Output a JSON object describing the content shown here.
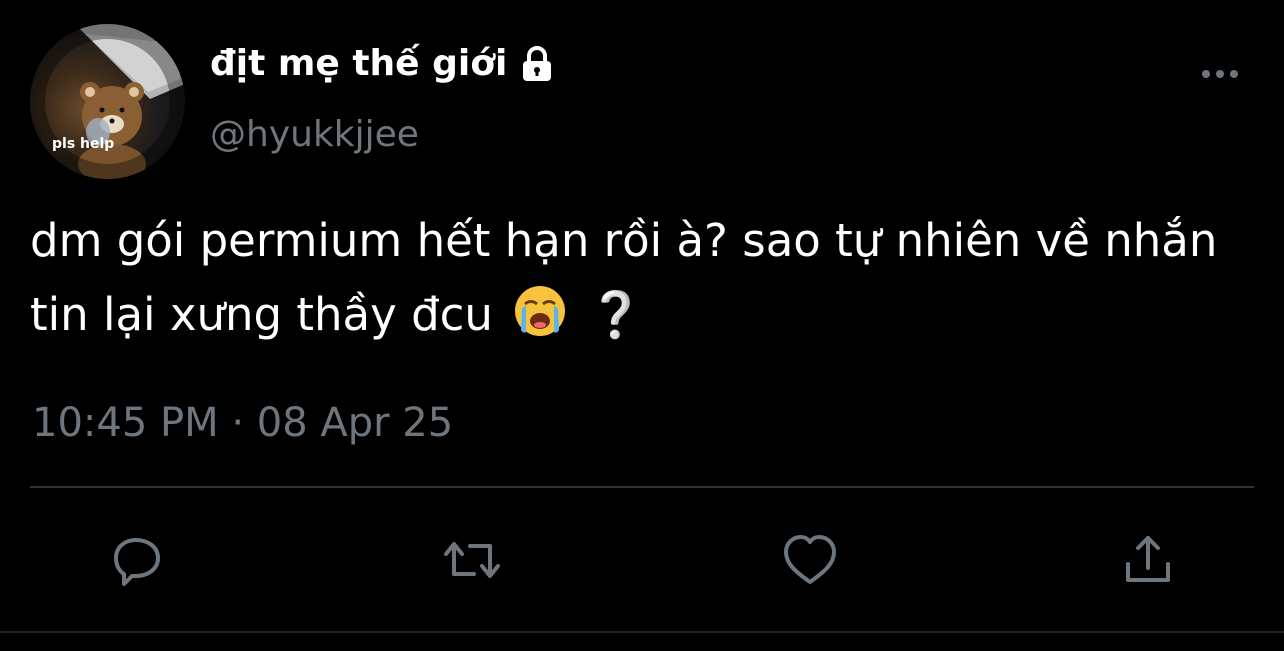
{
  "profile": {
    "display_name": "địt mẹ thế giới",
    "handle": "@hyukkjjee",
    "avatar_caption": "pls help",
    "protected": true
  },
  "tweet": {
    "text": "dm gói permium hết hạn rồi à? sao tự nhiên về nhắn tin lại xưng thầy đcu",
    "trailing_emoji": "loudly-crying-face",
    "trailing_mark": "❔",
    "timestamp": "10:45 PM · 08 Apr 25"
  },
  "actions": [
    {
      "name": "reply",
      "icon": "speech-bubble-icon"
    },
    {
      "name": "retweet",
      "icon": "retweet-arrows-icon"
    },
    {
      "name": "like",
      "icon": "heart-icon"
    },
    {
      "name": "share",
      "icon": "share-upload-icon"
    }
  ],
  "colors": {
    "background": "#000000",
    "primary_text": "#ffffff",
    "secondary_text": "#6e767d",
    "divider": "#2f3336"
  }
}
